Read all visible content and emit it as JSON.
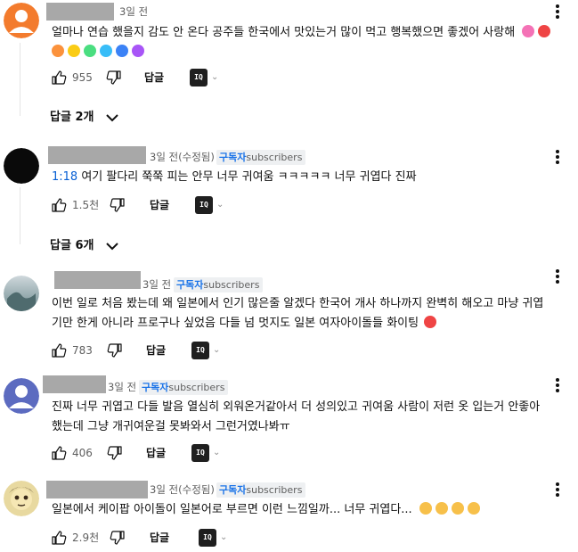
{
  "common": {
    "reply_label": "답글",
    "iq_label": "IQ"
  },
  "comments": [
    {
      "date": "3일 전",
      "badge": null,
      "text_lines": [
        "얼마나 연습 했을지 감도 안 온다 공주들 한국에서 맛있는거 많이 먹고 행복했으면 좋겠어 사랑해"
      ],
      "emoji_colors": [
        "#f472b6",
        "#ef4444",
        "#fb923c",
        "#facc15",
        "#4ade80",
        "#38bdf8",
        "#3b82f6",
        "#a855f7"
      ],
      "likes": "955",
      "replies_label": "답글 2개"
    },
    {
      "date": "3일 전(수정됨)",
      "badge": {
        "ko": "구독자",
        "en": "subscribers"
      },
      "timestamp": "1:18",
      "text_lines": [
        " 여기 팔다리 쭉쭉 피는 안무 너무 귀여움 ㅋㅋㅋㅋㅋ 너무 귀엽다 진짜"
      ],
      "likes": "1.5천",
      "replies_label": "답글 6개"
    },
    {
      "date": "3일 전",
      "badge": {
        "ko": "구독자",
        "en": "subscribers"
      },
      "text_lines": [
        "이번 일로 처음 봤는데 왜 일본에서 인기 많은줄 알겠다 한국어 개사 하나까지 완벽히 해오고 마냥 귀엽",
        "기만 한게 아니라 프로구나 싶었음 다들 넘 멋지도 일본 여자아이돌들 화이팅"
      ],
      "likes": "783"
    },
    {
      "date": "3일 전",
      "badge": {
        "ko": "구독자",
        "en": "subscribers"
      },
      "text_lines": [
        "진짜 너무 귀엽고 다들 발음 열심히 외워온거같아서 더 성의있고 귀여움 사람이 저런 옷 입는거 안좋아",
        "했는데 그냥 개귀여운걸 못봐와서 그런거였나봐ㅠ"
      ],
      "likes": "406"
    },
    {
      "date": "3일 전(수정됨)",
      "badge": {
        "ko": "구독자",
        "en": "subscribers"
      },
      "text_lines": [
        "일본에서 케이팝 아이돌이 일본어로 부르면 이런 느낌일까... 너무 귀엽다..."
      ],
      "likes": "2.9천"
    }
  ]
}
